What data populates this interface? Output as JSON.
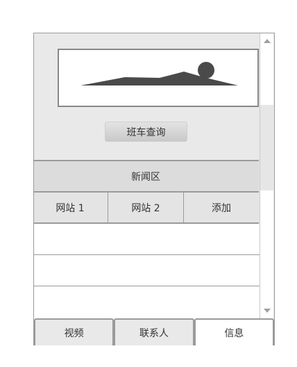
{
  "query_button": {
    "label": "班车查询"
  },
  "news": {
    "header": "新闻区",
    "site_tabs": [
      "网站 1",
      "网站 2",
      "添加"
    ],
    "rows": 3
  },
  "bottom_tabs": [
    {
      "label": "视频",
      "active": false
    },
    {
      "label": "联系人",
      "active": false
    },
    {
      "label": "信息",
      "active": true
    }
  ],
  "icons": {
    "scroll_up": "triangle-up-icon",
    "scroll_down": "triangle-down-icon",
    "image": "landscape-image-icon"
  },
  "colors": {
    "frame": "#9a9a9a",
    "panel": "#e9e9e9",
    "active_tab": "#ffffff"
  }
}
